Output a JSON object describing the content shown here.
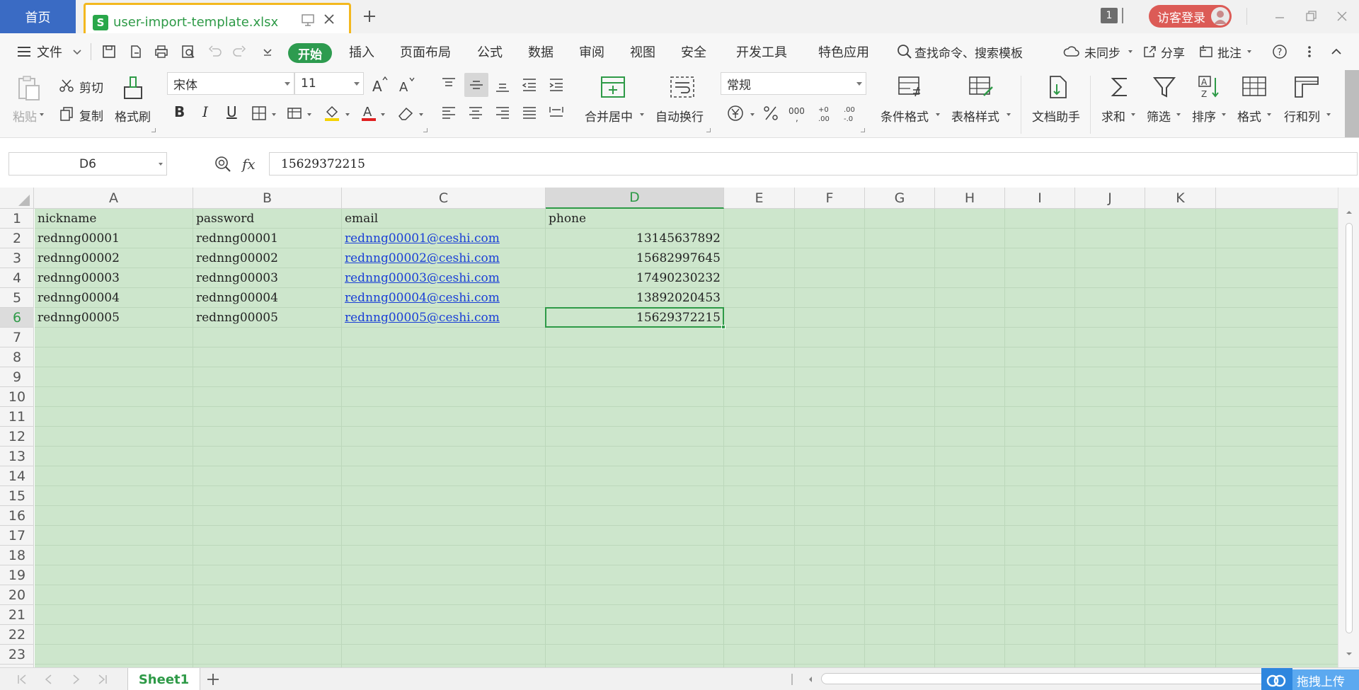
{
  "titlebar": {
    "home_tab": "首页",
    "doc_tab": "user-import-template.xlsx",
    "doc_logo": "S",
    "window_count": "1",
    "login_button": "访客登录"
  },
  "menu": {
    "file": "文件",
    "items": [
      "开始",
      "插入",
      "页面布局",
      "公式",
      "数据",
      "审阅",
      "视图",
      "安全",
      "开发工具",
      "特色应用"
    ],
    "search": "查找命令、搜索模板",
    "sync": "未同步",
    "share": "分享",
    "comment": "批注"
  },
  "ribbon": {
    "paste": "粘贴",
    "cut": "剪切",
    "copy": "复制",
    "format_painter": "格式刷",
    "font_name": "宋体",
    "font_size": "11",
    "merge_center": "合并居中",
    "wrap_text": "自动换行",
    "number_format": "常规",
    "cond_format": "条件格式",
    "table_style": "表格样式",
    "doc_assistant": "文档助手",
    "sum": "求和",
    "filter": "筛选",
    "sort": "排序",
    "format": "格式",
    "row_col": "行和列",
    "bold": "B",
    "italic": "I",
    "underline": "U"
  },
  "formula_bar": {
    "name_box": "D6",
    "fx": "fx",
    "value": "15629372215"
  },
  "grid": {
    "columns": [
      "A",
      "B",
      "C",
      "D",
      "E",
      "F",
      "G",
      "H",
      "I",
      "J",
      "K"
    ],
    "active_column": "D",
    "active_row": 6,
    "row_numbers": [
      "1",
      "2",
      "3",
      "4",
      "5",
      "6",
      "7",
      "8",
      "9",
      "10",
      "11",
      "12",
      "13",
      "14",
      "15",
      "16",
      "17",
      "18",
      "19",
      "20",
      "21",
      "22",
      "23"
    ],
    "rows": [
      {
        "nickname": "nickname",
        "password": "password",
        "email": "email",
        "phone": "phone"
      },
      {
        "nickname": "rednng00001",
        "password": "rednng00001",
        "email": "rednng00001@ceshi.com",
        "phone": "13145637892"
      },
      {
        "nickname": "rednng00002",
        "password": "rednng00002",
        "email": "rednng00002@ceshi.com",
        "phone": "15682997645"
      },
      {
        "nickname": "rednng00003",
        "password": "rednng00003",
        "email": "rednng00003@ceshi.com",
        "phone": "17490230232"
      },
      {
        "nickname": "rednng00004",
        "password": "rednng00004",
        "email": "rednng00004@ceshi.com",
        "phone": "13892020453"
      },
      {
        "nickname": "rednng00005",
        "password": "rednng00005",
        "email": "rednng00005@ceshi.com",
        "phone": "15629372215"
      }
    ]
  },
  "sheets": {
    "tabs": [
      "Sheet1"
    ],
    "upload": "拖拽上传"
  },
  "colors": {
    "accent_green": "#2e9a47",
    "home_tab_blue": "#3a6bc4",
    "tab_highlight": "#f3b81f",
    "sheet_fill": "#cde6cc",
    "link_blue": "#1a3fd6"
  }
}
